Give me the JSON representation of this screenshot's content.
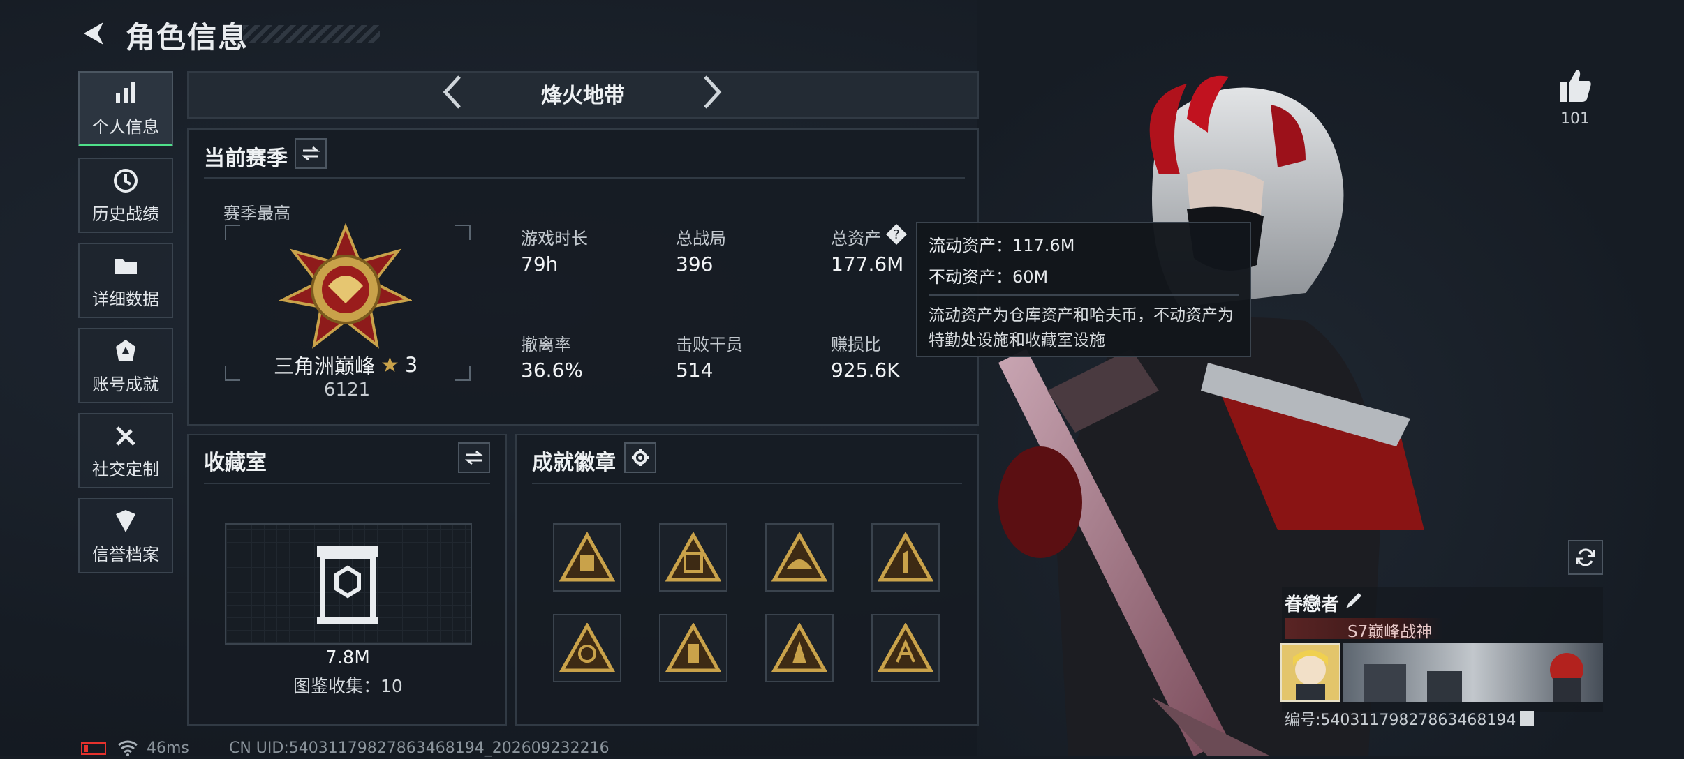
{
  "header": {
    "title": "角色信息"
  },
  "sidebar": {
    "items": [
      {
        "label": "个人信息",
        "icon": "bar-chart-icon",
        "active": true
      },
      {
        "label": "历史战绩",
        "icon": "clock-icon"
      },
      {
        "label": "详细数据",
        "icon": "folder-icon"
      },
      {
        "label": "账号成就",
        "icon": "achievement-icon"
      },
      {
        "label": "社交定制",
        "icon": "tools-icon"
      },
      {
        "label": "信誉档案",
        "icon": "shield-icon"
      }
    ]
  },
  "mode_tab": {
    "title": "烽火地带"
  },
  "season": {
    "title": "当前赛季",
    "best_label": "赛季最高",
    "rank_name": "三角洲巅峰",
    "rank_stars": "3",
    "rank_score": "6121",
    "stats": [
      {
        "label": "游戏时长",
        "value": "79h"
      },
      {
        "label": "总战局",
        "value": "396"
      },
      {
        "label": "总资产",
        "value": "177.6M"
      },
      {
        "label": "撤离率",
        "value": "36.6%"
      },
      {
        "label": "击败干员",
        "value": "514"
      },
      {
        "label": "赚损比",
        "value": "925.6K"
      }
    ]
  },
  "tooltip": {
    "liquid": "流动资产：117.6M",
    "fixed": "不动资产：60M",
    "note": "流动资产为仓库资产和哈夫币，不动资产为特勤处设施和收藏室设施"
  },
  "collection": {
    "title": "收藏室",
    "value": "7.8M",
    "catalog": "图鉴收集：10"
  },
  "badges": {
    "title": "成就徽章",
    "count": 8
  },
  "likes": {
    "count": "101"
  },
  "player": {
    "name": "眷戀者",
    "title_tag": "S7巅峰战神",
    "id_text": "编号:540311798278634681​94"
  },
  "footer": {
    "ping": "46ms",
    "uid": "CN UID:5403117982786346819​4_202609232216"
  },
  "colors": {
    "accent": "#4fe08a",
    "gold": "#c9a24a",
    "bg": "#161c24"
  }
}
